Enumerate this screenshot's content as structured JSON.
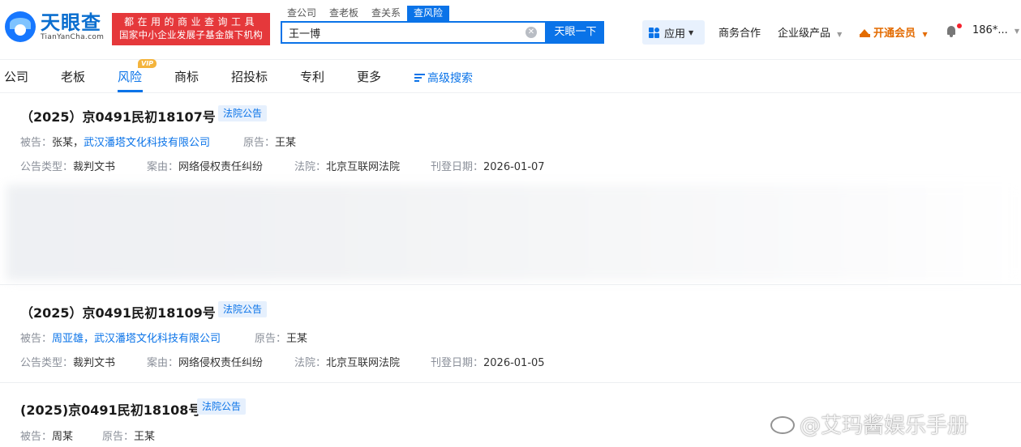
{
  "header": {
    "logo_cn": "天眼查",
    "logo_en": "TianYanCha.com",
    "slogan_line1": "都在用的商业查询工具",
    "slogan_line2": "国家中小企业发展子基金旗下机构",
    "search_tabs": [
      {
        "label": "查公司",
        "active": false
      },
      {
        "label": "查老板",
        "active": false
      },
      {
        "label": "查关系",
        "active": false
      },
      {
        "label": "查风险",
        "active": true
      }
    ],
    "search_value": "王一博",
    "search_button": "天眼一下",
    "app_button": "应用",
    "nav": {
      "business": "商务合作",
      "enterprise": "企业级产品",
      "vip": "开通会员",
      "user": "186*..."
    }
  },
  "subnav": {
    "items": [
      "公司",
      "老板",
      "风险",
      "商标",
      "招投标",
      "专利",
      "更多"
    ],
    "active": "风险",
    "vip_badge": "VIP",
    "advanced_search": "高级搜索"
  },
  "records": [
    {
      "title": "（2025）京0491民初18107号",
      "tag": "法院公告",
      "defendant_label": "被告：",
      "defendants_plain": "张某，",
      "defendants_link": "武汉潘塔文化科技有限公司",
      "plaintiff_label": "原告：",
      "plaintiff": "王某",
      "type_label": "公告类型：",
      "type": "裁判文书",
      "cause_label": "案由：",
      "cause": "网络侵权责任纠纷",
      "court_label": "法院：",
      "court": "北京互联网法院",
      "date_label": "刊登日期：",
      "date": "2026-01-07"
    },
    {
      "title": "（2025）京0491民初18109号",
      "tag": "法院公告",
      "defendant_label": "被告：",
      "defendants_link": "周亚雄，武汉潘塔文化科技有限公司",
      "plaintiff_label": "原告：",
      "plaintiff": "王某",
      "type_label": "公告类型：",
      "type": "裁判文书",
      "cause_label": "案由：",
      "cause": "网络侵权责任纠纷",
      "court_label": "法院：",
      "court": "北京互联网法院",
      "date_label": "刊登日期：",
      "date": "2026-01-05"
    },
    {
      "title": "(2025)京0491民初18108号",
      "tag": "法院公告",
      "defendant_label": "被告：",
      "defendants_plain": "周某",
      "plaintiff_label": "原告：",
      "plaintiff": "王某"
    }
  ],
  "watermark": "@艾玛酱娱乐手册",
  "colors": {
    "accent": "#0a73e8",
    "slogan_bg": "#e5383b",
    "vip": "#e36b00",
    "tag_bg": "#e6f0fd"
  }
}
